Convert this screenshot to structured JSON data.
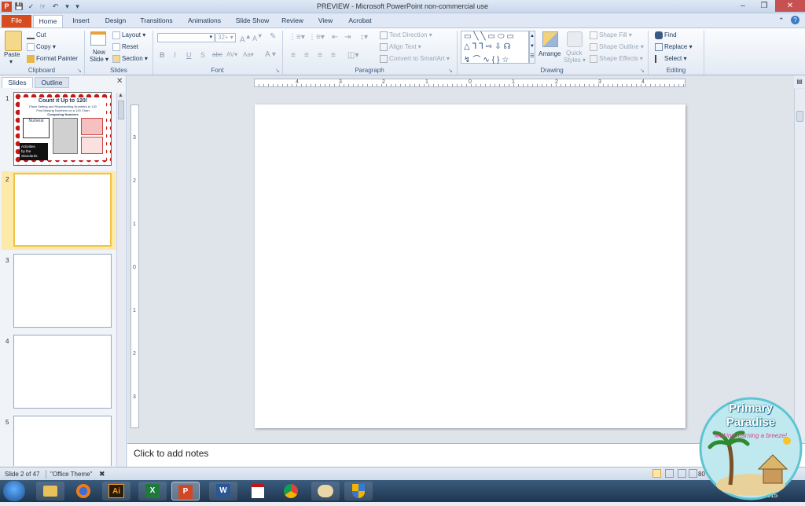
{
  "window": {
    "title": "PREVIEW - Microsoft PowerPoint non-commercial use"
  },
  "tabs": [
    "File",
    "Home",
    "Insert",
    "Design",
    "Transitions",
    "Animations",
    "Slide Show",
    "Review",
    "View",
    "Acrobat"
  ],
  "ribbon": {
    "clipboard": {
      "paste": "Paste",
      "cut": "Cut",
      "copy": "Copy",
      "format_painter": "Format Painter",
      "label": "Clipboard"
    },
    "slides": {
      "new_slide_1": "New",
      "new_slide_2": "Slide",
      "layout": "Layout",
      "reset": "Reset",
      "section": "Section",
      "label": "Slides"
    },
    "font": {
      "size": "32+",
      "bold": "B",
      "italic": "I",
      "underline": "U",
      "strike": "S",
      "shadow": "abc",
      "spacing": "AV",
      "case": "Aa",
      "color": "A",
      "label": "Font"
    },
    "paragraph": {
      "text_direction": "Text Direction",
      "align_text": "Align Text",
      "smartart": "Convert to SmartArt",
      "label": "Paragraph"
    },
    "drawing": {
      "arrange": "Arrange",
      "quick_1": "Quick",
      "quick_2": "Styles",
      "shape_fill": "Shape Fill",
      "shape_outline": "Shape Outline",
      "shape_effects": "Shape Effects",
      "label": "Drawing"
    },
    "editing": {
      "find": "Find",
      "replace": "Replace",
      "select": "Select",
      "label": "Editing"
    }
  },
  "pane": {
    "tabs": [
      "Slides",
      "Outline"
    ],
    "slide1": {
      "title": "Count it Up to 120!",
      "sub_1": "Place Setting and Representing Numbers to 120",
      "sub_2": "Find Missing Numbers on a 120 Chart",
      "sub_3": "Comparing Numbers",
      "numeral": "Numeral",
      "badge_1": "Activities",
      "badge_2": "by the",
      "badge_3": "Standards"
    },
    "numbers": [
      "1",
      "2",
      "3",
      "4",
      "5"
    ]
  },
  "ruler": {
    "h_ticks": [
      "4",
      "3",
      "2",
      "1",
      "0",
      "1",
      "2",
      "3",
      "4"
    ],
    "v_ticks": [
      "3",
      "2",
      "1",
      "0",
      "1",
      "2",
      "3"
    ]
  },
  "notes": {
    "placeholder": "Click to add notes"
  },
  "status": {
    "slide": "Slide 2 of 47",
    "theme": "\"Office Theme\"",
    "zoom": "80"
  },
  "taskbar": {
    "date_partial": "/20/2015",
    "icons": [
      "Ai",
      "X",
      "P",
      "W"
    ]
  },
  "logo": {
    "line1": "Primary",
    "line2": "Paradise",
    "tagline": "Making learning a breeze!"
  }
}
